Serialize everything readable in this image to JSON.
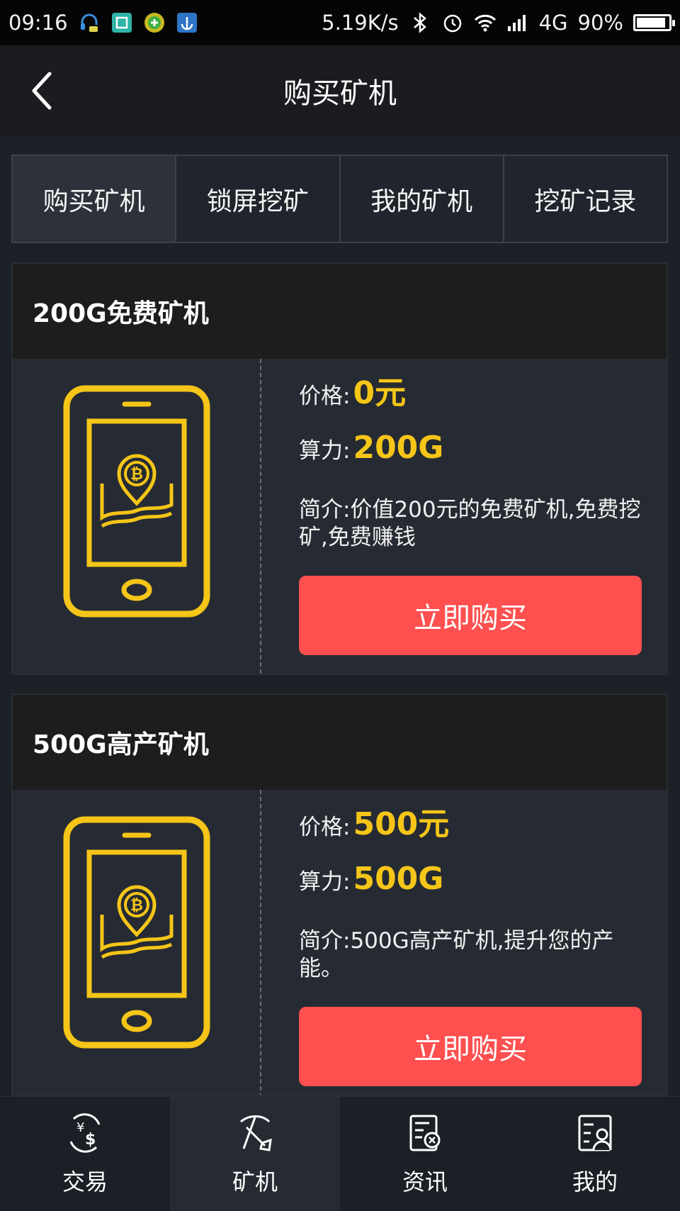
{
  "status_bar": {
    "time": "09:16",
    "speed": "5.19K/s",
    "network": "4G",
    "battery": "90%",
    "battery_level": 0.9,
    "icons": [
      "headset-icon",
      "scan-icon",
      "plus-coin-icon",
      "anchor-app-icon",
      "bluetooth-icon",
      "alarm-icon",
      "wifi-icon",
      "signal-icon"
    ]
  },
  "header": {
    "title": "购买矿机",
    "back_icon": "back-chevron-icon"
  },
  "tabs": [
    {
      "label": "购买矿机",
      "active": true
    },
    {
      "label": "锁屏挖矿",
      "active": false
    },
    {
      "label": "我的矿机",
      "active": false
    },
    {
      "label": "挖矿记录",
      "active": false
    }
  ],
  "products": [
    {
      "title": "200G免费矿机",
      "price_label": "价格:",
      "price": "0元",
      "power_label": "算力:",
      "power": "200G",
      "desc_label": "简介:",
      "desc": "价值200元的免费矿机,免费挖矿,免费赚钱",
      "buy_label": "立即购买",
      "icon": "bitcoin-phone-icon"
    },
    {
      "title": "500G高产矿机",
      "price_label": "价格:",
      "price": "500元",
      "power_label": "算力:",
      "power": "500G",
      "desc_label": "简介:",
      "desc": "500G高产矿机,提升您的产能。",
      "buy_label": "立即购买",
      "icon": "bitcoin-phone-icon"
    }
  ],
  "bottom_nav": [
    {
      "label": "交易",
      "icon": "exchange-currency-icon",
      "active": false
    },
    {
      "label": "矿机",
      "icon": "pickaxe-shovel-icon",
      "active": true
    },
    {
      "label": "资讯",
      "icon": "news-doc-icon",
      "active": false
    },
    {
      "label": "我的",
      "icon": "profile-card-icon",
      "active": false
    }
  ],
  "colors": {
    "accent_yellow": "#f5c518",
    "buy_button": "#ff4f4f",
    "background": "#1c2027",
    "card": "#262b33",
    "card_header": "#1d1d1d"
  }
}
